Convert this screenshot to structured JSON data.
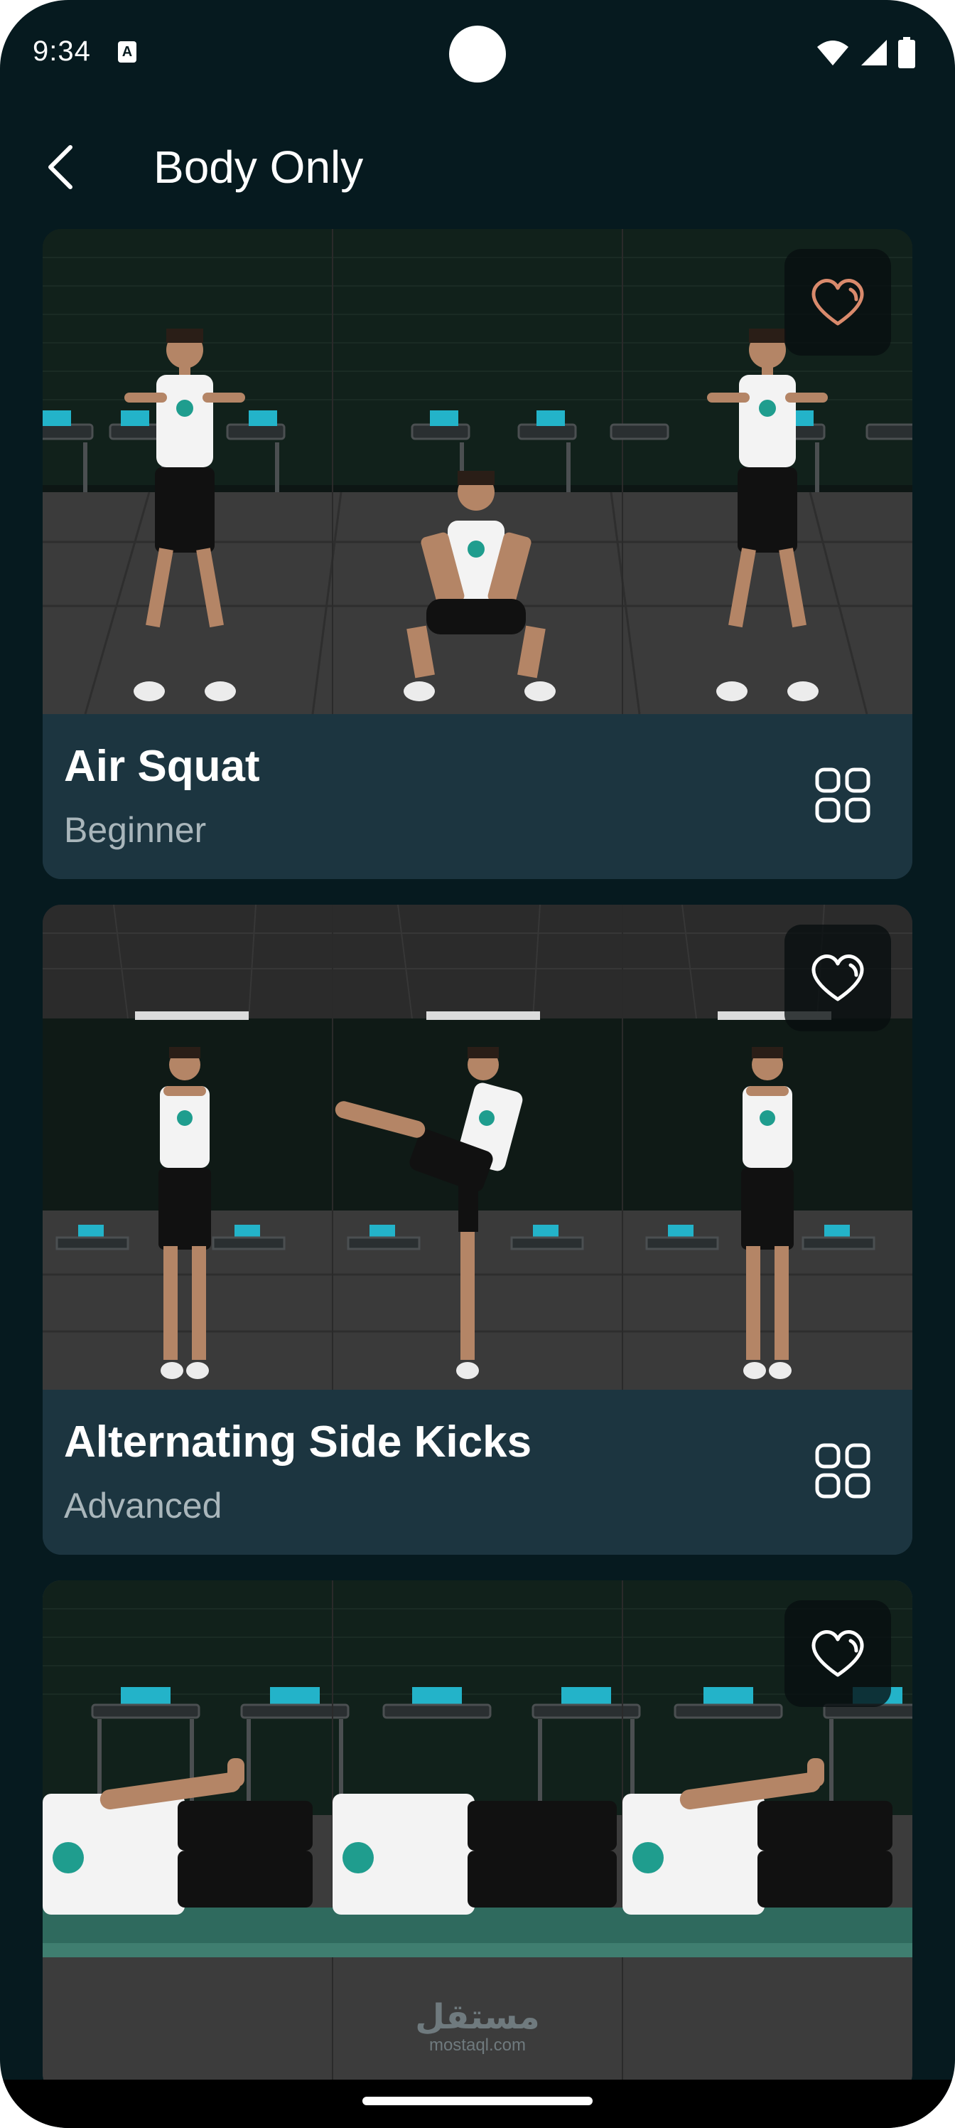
{
  "status_bar": {
    "time": "9:34",
    "notification_icon": "A"
  },
  "header": {
    "back_icon": "chevron-left-icon",
    "title": "Body Only"
  },
  "exercises": [
    {
      "name": "Air Squat",
      "level": "Beginner",
      "favorite_color": "#d98a6c"
    },
    {
      "name": "Alternating Side Kicks",
      "level": "Advanced",
      "favorite_color": "#ffffff"
    },
    {
      "name": "",
      "level": "",
      "favorite_color": "#ffffff"
    }
  ],
  "watermark": {
    "arabic": "مستقل",
    "latin": "mostaql.com"
  },
  "colors": {
    "background": "#061a1f",
    "card_footer": "#1c3540",
    "level_text": "#a9b6bb"
  }
}
